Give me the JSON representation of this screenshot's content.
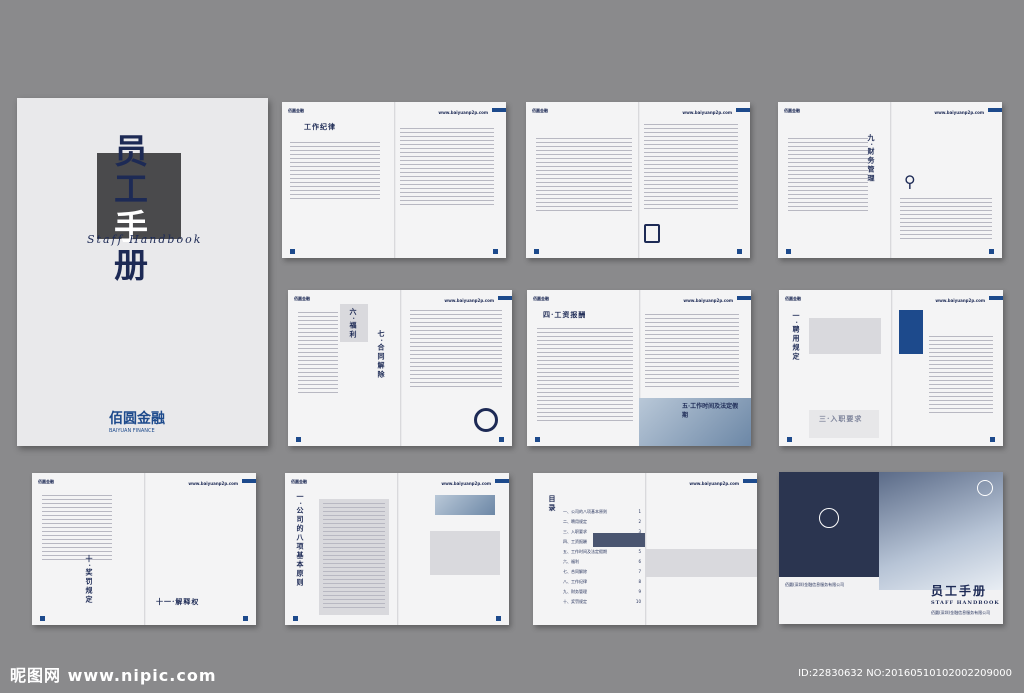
{
  "cover": {
    "title_chars": [
      "员",
      "工",
      "手",
      "册"
    ],
    "subtitle_en": "Staff Handbook",
    "logo_name": "佰圆金融",
    "logo_en": "BAIYUAN FINANCE"
  },
  "spreads": {
    "header_brand": "佰圆金融",
    "url": "www.baiyuanp2p.com",
    "s1_title": "工作纪律",
    "s3_title": "九·财务管理",
    "s4_left": "六·福利",
    "s4_right": "七·合同解除",
    "s5_title": "四·工资报酬",
    "s5_photo_caption": "五·工作时间及法定假期",
    "s6_left": "一·聘用规定",
    "s6_right": "三·入职要求",
    "s7_left": "十·奖罚规定",
    "s7_right": "十一·解释权",
    "s8_title": "一·公司的八项基本原则",
    "s9_title": "目录",
    "toc": [
      "一、公司的八项基本原则",
      "二、聘用规定",
      "三、入职要求",
      "四、工资报酬",
      "五、工作时间及法定假期",
      "六、福利",
      "七、合同解除",
      "八、工作纪律",
      "九、财务管理",
      "十、奖罚规定"
    ],
    "toc_pages": [
      "1",
      "2",
      "3",
      "4",
      "5",
      "6",
      "7",
      "8",
      "9",
      "10"
    ]
  },
  "back_cover": {
    "title": "员工手册",
    "subtitle_en": "STAFF HANDBOOK",
    "company": "佰圆(深圳)金融信息服务有限公司"
  },
  "watermark": {
    "left": "昵图网 www.nipic.com",
    "right": "ID:22830632 NO:20160510102002209000"
  }
}
